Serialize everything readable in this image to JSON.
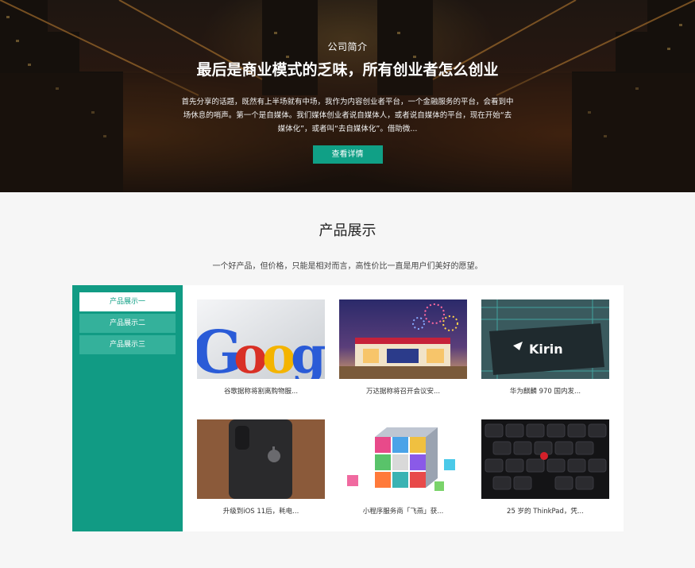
{
  "hero": {
    "kicker": "公司简介",
    "title": "最后是商业模式的乏味，所有创业者怎么创业",
    "description": "首先分享的话题，既然有上半场就有中场，我作为内容创业者平台，一个金融服务的平台，会看到中场休息的哨声。第一个是自媒体。我们媒体创业者说自媒体人，或者说自媒体的平台，现在开始“去媒体化”，或者叫“去自媒体化”。借助微...",
    "button_label": "查看详情"
  },
  "products": {
    "title": "产品展示",
    "subtitle": "一个好产品，但价格，只能是相对而言，高性价比一直是用户们美好的愿望。",
    "tabs": [
      "产品展示一",
      "产品展示二",
      "产品展示三"
    ],
    "items": [
      {
        "caption": "谷歌据称将割离购物服...",
        "image": "google-logo-image"
      },
      {
        "caption": "万达据称将召开会议安...",
        "image": "wanda-plaza-image"
      },
      {
        "caption": "华为麒麟 970 国内发...",
        "image": "kirin-chip-image"
      },
      {
        "caption": "升级到iOS 11后，耗电...",
        "image": "iphone-back-image"
      },
      {
        "caption": "小程序服务商「飞燕」获...",
        "image": "app-cube-image"
      },
      {
        "caption": "25 岁的 ThinkPad，凭...",
        "image": "thinkpad-keyboard-image"
      }
    ]
  },
  "colors": {
    "accent": "#10a086",
    "sidebar": "#119b84"
  }
}
